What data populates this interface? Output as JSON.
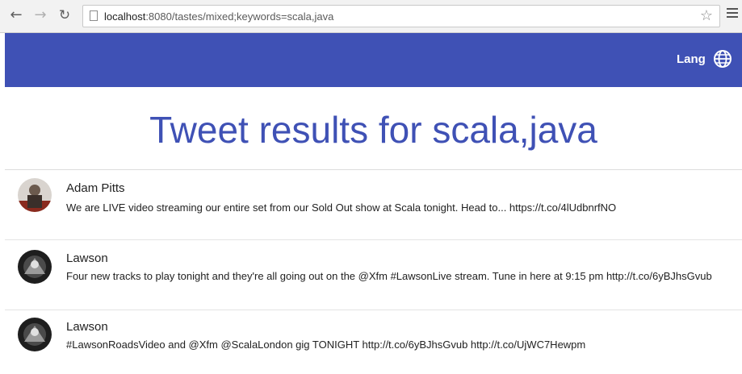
{
  "browser": {
    "url_host": "localhost",
    "url_path": ":8080/tastes/mixed;keywords=scala,java",
    "icons": [
      "back-arrow-icon",
      "forward-arrow-icon",
      "reload-icon",
      "page-icon",
      "star-icon",
      "menu-icon"
    ]
  },
  "header": {
    "lang_label": "Lang",
    "icon": "globe-icon",
    "background": "#3f51b5"
  },
  "main": {
    "title": "Tweet results for scala,java",
    "title_color": "#3f51b5"
  },
  "tweets": [
    {
      "author": "Adam Pitts",
      "text": "We are LIVE video streaming our entire set from our Sold Out show at Scala tonight. Head to... https://t.co/4lUdbnrfNO"
    },
    {
      "author": "Lawson",
      "text": "Four new tracks to play tonight and they're all going out on the @Xfm #LawsonLive stream. Tune in here at 9:15 pm http://t.co/6yBJhsGvub"
    },
    {
      "author": "Lawson",
      "text": "#LawsonRoadsVideo and @Xfm @ScalaLondon gig TONIGHT http://t.co/6yBJhsGvub http://t.co/UjWC7Hewpm"
    }
  ]
}
